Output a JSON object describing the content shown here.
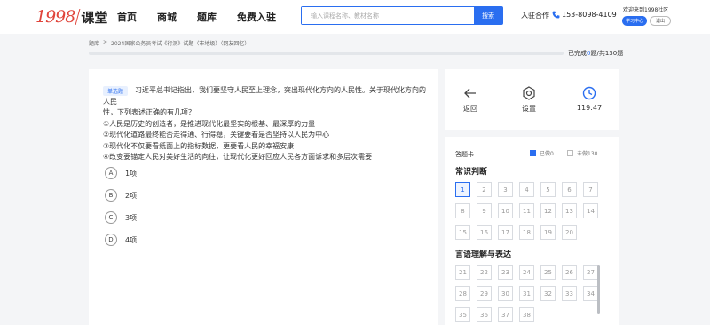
{
  "header": {
    "logo_num": "1998",
    "logo_cn": "课堂",
    "nav": [
      "首页",
      "商城",
      "题库",
      "免费入驻"
    ],
    "search_placeholder": "输入课程名称、教材名称",
    "search_button": "搜索",
    "join": "入驻合作",
    "phone": "153-8098-4109",
    "welcome": "欢迎来到1998社区",
    "study_center": "学习中心",
    "logout": "退出"
  },
  "breadcrumb": {
    "home": "题库",
    "sep": ">",
    "title": "2024国家公务员考试《行测》试题（市地级）（网友回忆）"
  },
  "progress": {
    "prefix": "已完成",
    "done": "0",
    "suffix": "题/共130题",
    "fraction": 0
  },
  "question": {
    "type": "单选题",
    "text_line1": "习近平总书记指出，我们要坚守人民至上理念，突出现代化方向的人民性。关于现代化方向的人民",
    "text_line2": "性，下列表述正确的有几项？",
    "items": [
      "①人民是历史的创造者，是推进现代化最坚实的根基、最深厚的力量",
      "②现代化道路最终能否走得通、行得稳，关键要看是否坚持以人民为中心",
      "③现代化不仅要看纸面上的指标数据，更要看人民的幸福安康",
      "④改变要锚定人民对美好生活的向往，让现代化更好回应人民各方面诉求和多层次需要"
    ],
    "options": [
      {
        "letter": "A",
        "text": "1项"
      },
      {
        "letter": "B",
        "text": "2项"
      },
      {
        "letter": "C",
        "text": "3项"
      },
      {
        "letter": "D",
        "text": "4项"
      }
    ]
  },
  "tools": {
    "back": "返回",
    "settings": "设置",
    "timer": "119:47"
  },
  "answer_card": {
    "title": "答题卡",
    "answered": "已做0",
    "unanswered": "未做130",
    "answered_color": "#2a6ef0",
    "sections": [
      {
        "name": "常识判断",
        "numbers": [
          "1",
          "2",
          "3",
          "4",
          "5",
          "6",
          "7",
          "8",
          "9",
          "10",
          "11",
          "12",
          "13",
          "14",
          "15",
          "16",
          "17",
          "18",
          "19",
          "20"
        ]
      },
      {
        "name": "言语理解与表达",
        "numbers": [
          "21",
          "22",
          "23",
          "24",
          "25",
          "26",
          "27",
          "28",
          "29",
          "30",
          "31",
          "32",
          "33",
          "34",
          "35",
          "36",
          "37",
          "38"
        ]
      }
    ]
  }
}
